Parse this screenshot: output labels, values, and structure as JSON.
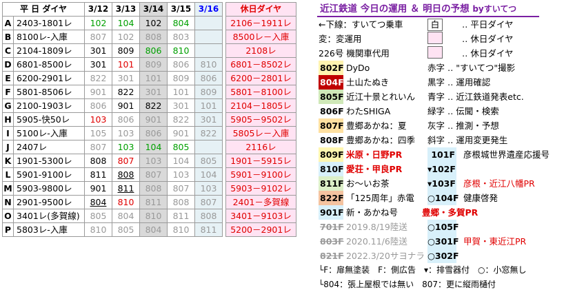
{
  "header": {
    "heijitsu_label": "平 日 ダイヤ",
    "dates": [
      "3/12",
      "3/13",
      "3/14",
      "3/15",
      "3/16"
    ],
    "kyujitsu_label": "休日ダイヤ"
  },
  "rows": [
    {
      "id": "A",
      "w": "2403-1801レ",
      "v": [
        {
          "t": "102",
          "c": "g"
        },
        {
          "t": "104",
          "c": "g"
        },
        {
          "t": "102",
          "c": "k"
        },
        {
          "t": "804",
          "c": "g"
        },
        {
          "t": "",
          "c": "k"
        }
      ],
      "h": "2106－1911レ"
    },
    {
      "id": "B",
      "w": "8100レ-入庫",
      "v": [
        {
          "t": "807",
          "c": "gr"
        },
        {
          "t": "102",
          "c": "gr"
        },
        {
          "t": "808",
          "c": "gr"
        },
        {
          "t": "803",
          "c": "gr"
        },
        {
          "t": "",
          "c": "k"
        }
      ],
      "h": "8500レ－入庫"
    },
    {
      "id": "C",
      "w": "2104-1809レ",
      "v": [
        {
          "t": "301",
          "c": "k"
        },
        {
          "t": "809",
          "c": "k"
        },
        {
          "t": "806",
          "c": "g"
        },
        {
          "t": "810",
          "c": "g"
        },
        {
          "t": "",
          "c": "k"
        }
      ],
      "h": "2108レ"
    },
    {
      "id": "D",
      "w": "6801-8500レ",
      "v": [
        {
          "t": "301",
          "c": "k"
        },
        {
          "t": "101",
          "c": "r"
        },
        {
          "t": "809",
          "c": "gr"
        },
        {
          "t": "806",
          "c": "gr"
        },
        {
          "t": "810",
          "c": "gr"
        }
      ],
      "h": "6801－8502レ"
    },
    {
      "id": "E",
      "w": "6200-2901レ",
      "v": [
        {
          "t": "822",
          "c": "gr"
        },
        {
          "t": "301",
          "c": "gr"
        },
        {
          "t": "101",
          "c": "gr"
        },
        {
          "t": "809",
          "c": "gr"
        },
        {
          "t": "806",
          "c": "gr"
        }
      ],
      "h": "6200－2801レ"
    },
    {
      "id": "F",
      "w": "5801-8506レ",
      "v": [
        {
          "t": "901",
          "c": "gr"
        },
        {
          "t": "822",
          "c": "k"
        },
        {
          "t": "301",
          "c": "gr"
        },
        {
          "t": "101",
          "c": "gr"
        },
        {
          "t": "809",
          "c": "gr"
        }
      ],
      "h": "5801－8100レ"
    },
    {
      "id": "G",
      "w": "2100-1903レ",
      "v": [
        {
          "t": "806",
          "c": "gr"
        },
        {
          "t": "901",
          "c": "k"
        },
        {
          "t": "822",
          "c": "k"
        },
        {
          "t": "301",
          "c": "gr"
        },
        {
          "t": "101",
          "c": "gr"
        }
      ],
      "h": "2104－1805レ"
    },
    {
      "id": "H",
      "w": "5905-快50レ",
      "v": [
        {
          "t": "103",
          "c": "r"
        },
        {
          "t": "806",
          "c": "gr"
        },
        {
          "t": "901",
          "c": "gr"
        },
        {
          "t": "822",
          "c": "gr"
        },
        {
          "t": "301",
          "c": "gr"
        }
      ],
      "h": "5905－9502レ"
    },
    {
      "id": "I",
      "w": "5100レ-入庫",
      "v": [
        {
          "t": "105",
          "c": "gr"
        },
        {
          "t": "103",
          "c": "gr"
        },
        {
          "t": "806",
          "c": "gr"
        },
        {
          "t": "901",
          "c": "gr"
        },
        {
          "t": "822",
          "c": "gr"
        }
      ],
      "h": "5805レ－入庫"
    },
    {
      "id": "J",
      "w": "2407レ",
      "v": [
        {
          "t": "807",
          "c": "gr"
        },
        {
          "t": "103",
          "c": "g"
        },
        {
          "t": "104",
          "c": "g"
        },
        {
          "t": "805",
          "c": "g"
        },
        {
          "t": "",
          "c": "k"
        }
      ],
      "h": "2116レ"
    },
    {
      "id": "K",
      "w": "1901-5300レ",
      "v": [
        {
          "t": "808",
          "c": "k"
        },
        {
          "t": "807",
          "c": "r"
        },
        {
          "t": "103",
          "c": "gr"
        },
        {
          "t": "104",
          "c": "gr"
        },
        {
          "t": "805",
          "c": "gr"
        }
      ],
      "h": "1901－5915レ"
    },
    {
      "id": "L",
      "w": "5901-9100レ",
      "v": [
        {
          "t": "811",
          "c": "k"
        },
        {
          "t": "808",
          "c": "ku"
        },
        {
          "t": "807",
          "c": "gr"
        },
        {
          "t": "103",
          "c": "gr"
        },
        {
          "t": "104",
          "c": "gr"
        }
      ],
      "h": "5901－9100レ"
    },
    {
      "id": "M",
      "w": "5903-9800レ",
      "v": [
        {
          "t": "901",
          "c": "k"
        },
        {
          "t": "811",
          "c": "ku"
        },
        {
          "t": "808",
          "c": "gr"
        },
        {
          "t": "807",
          "c": "gr"
        },
        {
          "t": "103",
          "c": "gr"
        }
      ],
      "h": "5903－9102レ"
    },
    {
      "id": "N",
      "w": "2901-9500レ",
      "v": [
        {
          "t": "804",
          "c": "ku"
        },
        {
          "t": "810",
          "c": "r"
        },
        {
          "t": "811",
          "c": "gr"
        },
        {
          "t": "808",
          "c": "gr"
        },
        {
          "t": "807",
          "c": "gr"
        }
      ],
      "h": "2401－多賀線"
    },
    {
      "id": "O",
      "w": "3401レ(多賀線)",
      "v": [
        {
          "t": "805",
          "c": "gr"
        },
        {
          "t": "804",
          "c": "gr"
        },
        {
          "t": "810",
          "c": "gr"
        },
        {
          "t": "811",
          "c": "gr"
        },
        {
          "t": "808",
          "c": "gr"
        }
      ],
      "h": "3401－9103レ"
    },
    {
      "id": "P",
      "w": "5803レ-入庫",
      "v": [
        {
          "t": "810",
          "c": "gr"
        },
        {
          "t": "805",
          "c": "gr"
        },
        {
          "t": "804",
          "c": "gr"
        },
        {
          "t": "810",
          "c": "gr"
        },
        {
          "t": "811",
          "c": "gr"
        }
      ],
      "h": "5200－2901レ"
    }
  ],
  "right": {
    "title": "近江鉄道 今日の運用 ＆ 明日の予想",
    "title_by": "byすいてつ",
    "legend": [
      {
        "a": "←下線：すいてつ乗車",
        "box": "白",
        "b": "‥ 平日ダイヤ"
      },
      {
        "a": "変：変運用",
        "box": "",
        "b": "‥ 休日ダイヤ"
      },
      {
        "a": "226号 機関車代用",
        "box": "",
        "b": "‥ 休日ダイヤ"
      }
    ],
    "cars": [
      {
        "num": "802F",
        "name": "DyDo",
        "cls": "car-dydo",
        "note": "赤字 ‥ \"すいてつ\"撮影"
      },
      {
        "num": "804F",
        "name": "土山たぬき",
        "cls": "car-tanuki",
        "note": "黒字 ‥ 運用確認"
      },
      {
        "num": "805F",
        "name": "近江十景とれいん",
        "cls": "car-juk",
        "note": "青字 ‥ 近江鉄道発表etc."
      },
      {
        "num": "806F",
        "name": "わたSHIGA",
        "cls": "car-white",
        "note": "緑字 ‥ 伝聞・検索"
      },
      {
        "num": "807F",
        "name": "豊郷あかね：夏",
        "cls": "car-bunb",
        "note": "灰字 ‥ 推測・予想"
      },
      {
        "num": "808F",
        "name": "豊郷あかね：四季",
        "cls": "car-white",
        "note": "斜字 ‥ 運用変更発生"
      }
    ],
    "cars2": [
      {
        "num": "809F",
        "name": "米原・日野PR",
        "right_num": "101F",
        "right": "彦根城世界遺産応援号"
      },
      {
        "num": "810F",
        "name": "愛荘・甲良PR",
        "right_num": "▾102F",
        "right": ""
      },
      {
        "num": "811F",
        "name": "お～いお茶",
        "right_num": "▾103F",
        "right": "彦根・近江八幡PR"
      },
      {
        "num": "822F",
        "name": "「125周年」赤電",
        "right_num": "○104F",
        "right": "健康啓発"
      },
      {
        "num": "901F",
        "name": "新・あかね号",
        "right_num": "",
        "right": "豊郷・多賀PR"
      },
      {
        "num": "701F",
        "name": "2019.8/19陸送",
        "right_num": "○105F",
        "right": ""
      },
      {
        "num": "803F",
        "name": "2020.11/6陸送",
        "right_num": "○301F",
        "right": "甲賀・東近江PR"
      },
      {
        "num": "821F",
        "name": "2022.3/20サヨナラ",
        "right_num": "○302F",
        "right": ""
      }
    ],
    "foot1": "└F：扉無塗装　F：側広告　▾：排雪器付　○：小窓無し",
    "foot2": "└804：張上屋根では無い　807：更に縦雨樋付"
  }
}
